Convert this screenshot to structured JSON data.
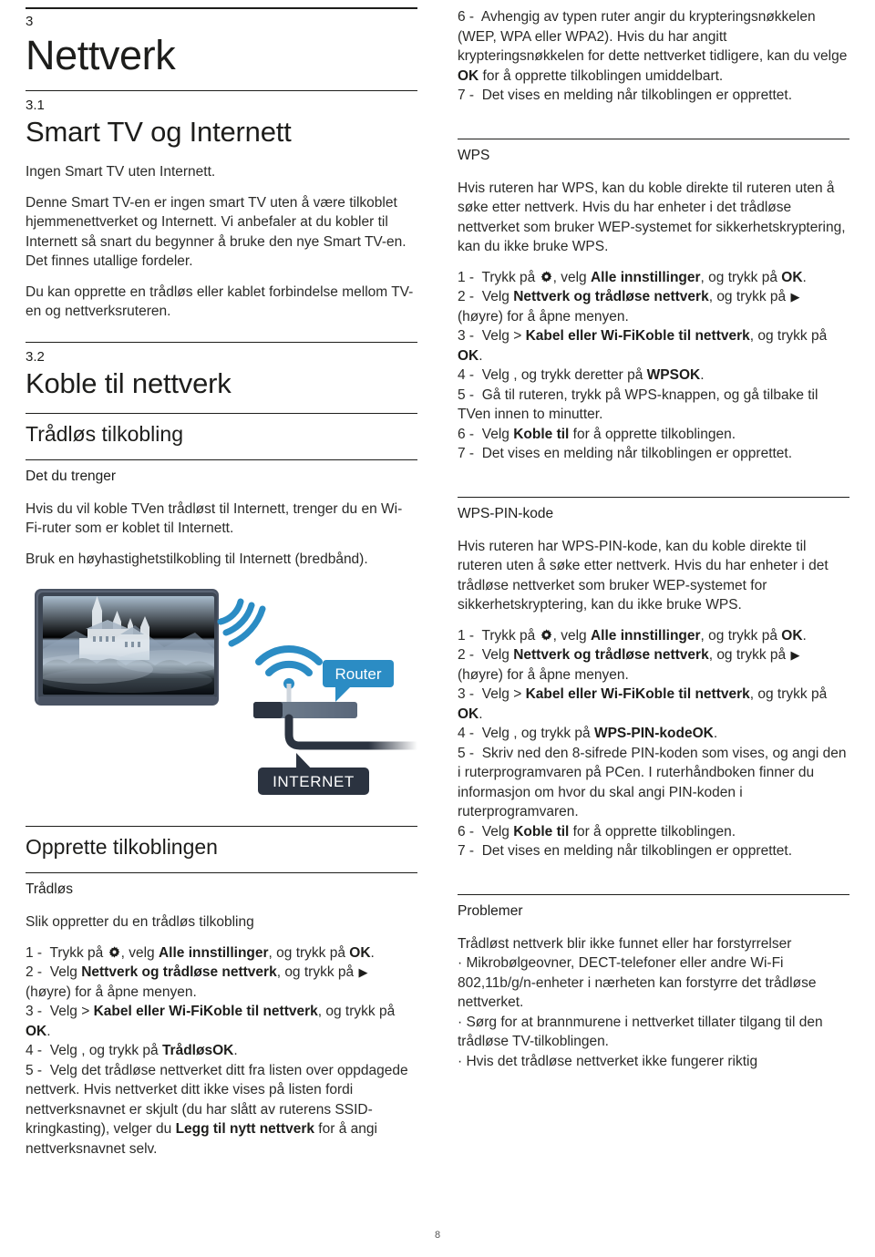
{
  "page": {
    "number": "8",
    "chapter_number": "3",
    "chapter_title": "Nettverk"
  },
  "left_column": {
    "section_3_1": {
      "number": "3.1",
      "title": "Smart TV og Internett",
      "lead": "Ingen Smart TV uten Internett.",
      "paragraph_1": "Denne Smart TV-en er ingen smart TV uten å være tilkoblet hjemmenettverket og Internett. Vi anbefaler at du kobler til Internett så snart du begynner å bruke den nye Smart TV-en. Det finnes utallige fordeler.",
      "paragraph_2": "Du kan opprette en trådløs eller kablet forbindelse mellom TV-en og nettverksruteren."
    },
    "section_3_2": {
      "number": "3.2",
      "title": "Koble til nettverk",
      "subhead_wireless": "Trådløs tilkobling",
      "minihead_needs": "Det du trenger",
      "needs_paragraph_1": "Hvis du vil koble TVen trådløst til Internett, trenger du en Wi-Fi-ruter som er koblet til Internett.",
      "needs_paragraph_2": "Bruk en høyhastighetstilkobling til Internett (bredbånd).",
      "illustration": {
        "router_label": "Router",
        "internet_label": "INTERNET",
        "tv_name": "tv-with-castle-image",
        "wifi_name": "wifi-signal-icon"
      },
      "subhead_connect": "Opprette tilkoblingen",
      "minihead_wireless": "Trådløs",
      "intro_wireless": "Slik oppretter du en trådløs tilkobling",
      "steps": [
        {
          "num": "1 -",
          "pre": "Trykk på ",
          "icon": "gear-icon",
          "mid": ", velg ",
          "bold1": "Alle innstillinger",
          "post": ", og trykk på ",
          "bold2": "OK",
          "tail": "."
        },
        {
          "num": "2 -",
          "pre": "Velg ",
          "bold1": "Nettverk og trådløse nettverk",
          "mid": ", og trykk på ",
          "icon": "arrow-right-icon",
          "post": " (høyre) for å åpne menyen."
        },
        {
          "num": "3 -",
          "pre": "Velg ",
          "bold1": "Kabel eller Wi-Fi",
          "mid": " > ",
          "bold2": "Koble til nettverk",
          "post": ", og trykk på ",
          "bold3": "OK",
          "tail": "."
        },
        {
          "num": "4 -",
          "pre": "Velg ",
          "bold1": "Trådløs",
          "mid": ", og trykk på ",
          "bold2": "OK",
          "tail": "."
        },
        {
          "num": "5 -",
          "pre": "Velg det trådløse nettverket ditt fra listen over oppdagede nettverk. Hvis nettverket ditt ikke vises på listen fordi nettverksnavnet er skjult (du har slått av ruterens SSID-kringkasting), velger du ",
          "bold1": "Legg til nytt nettverk",
          "post": " for å angi nettverksnavnet selv."
        }
      ]
    }
  },
  "right_column": {
    "continued_steps": [
      {
        "num": "6 -",
        "pre": "Avhengig av typen ruter angir du krypteringsnøkkelen (WEP, WPA eller WPA2). Hvis du har angitt krypteringsnøkkelen for dette nettverket tidligere, kan du velge ",
        "bold1": "OK",
        "post": " for å opprette tilkoblingen umiddelbart."
      },
      {
        "num": "7 -",
        "pre": "Det vises en melding når tilkoblingen er opprettet."
      }
    ],
    "wps": {
      "minihead": "WPS",
      "paragraph": "Hvis ruteren har WPS, kan du koble direkte til ruteren uten å søke etter nettverk. Hvis du har enheter i det trådløse nettverket som bruker WEP-systemet for sikkerhetskryptering, kan du ikke bruke WPS.",
      "steps": [
        {
          "num": "1 -",
          "pre": "Trykk på ",
          "icon": "gear-icon",
          "mid": ", velg ",
          "bold1": "Alle innstillinger",
          "post": ", og trykk på ",
          "bold2": "OK",
          "tail": "."
        },
        {
          "num": "2 -",
          "pre": "Velg ",
          "bold1": "Nettverk og trådløse nettverk",
          "mid": ", og trykk på ",
          "icon": "arrow-right-icon",
          "post": " (høyre) for å åpne menyen."
        },
        {
          "num": "3 -",
          "pre": "Velg ",
          "bold1": "Kabel eller Wi-Fi",
          "mid": " > ",
          "bold2": "Koble til nettverk",
          "post": ", og trykk på ",
          "bold3": "OK",
          "tail": "."
        },
        {
          "num": "4 -",
          "pre": "Velg ",
          "bold1": "WPS",
          "mid": ", og trykk deretter på ",
          "bold2": "OK",
          "tail": "."
        },
        {
          "num": "5 -",
          "pre": "Gå til ruteren, trykk på WPS-knappen, og gå tilbake til TVen innen to minutter."
        },
        {
          "num": "6 -",
          "pre": "Velg ",
          "bold1": "Koble til",
          "post": " for å opprette tilkoblingen."
        },
        {
          "num": "7 -",
          "pre": "Det vises en melding når tilkoblingen er opprettet."
        }
      ]
    },
    "wps_pin": {
      "minihead": "WPS-PIN-kode",
      "paragraph": "Hvis ruteren har WPS-PIN-kode, kan du koble direkte til ruteren uten å søke etter nettverk. Hvis du har enheter i det trådløse nettverket som bruker WEP-systemet for sikkerhetskryptering, kan du ikke bruke WPS.",
      "steps": [
        {
          "num": "1 -",
          "pre": "Trykk på ",
          "icon": "gear-icon",
          "mid": ", velg ",
          "bold1": "Alle innstillinger",
          "post": ", og trykk på ",
          "bold2": "OK",
          "tail": "."
        },
        {
          "num": "2 -",
          "pre": "Velg ",
          "bold1": "Nettverk og trådløse nettverk",
          "mid": ", og trykk på ",
          "icon": "arrow-right-icon",
          "post": " (høyre) for å åpne menyen."
        },
        {
          "num": "3 -",
          "pre": "Velg ",
          "bold1": "Kabel eller Wi-Fi",
          "mid": " > ",
          "bold2": "Koble til nettverk",
          "post": ", og trykk på ",
          "bold3": "OK",
          "tail": "."
        },
        {
          "num": "4 -",
          "pre": "Velg ",
          "bold1": "WPS-PIN-kode",
          "mid": ", og trykk på ",
          "bold2": "OK",
          "tail": "."
        },
        {
          "num": "5 -",
          "pre": "Skriv ned den 8-sifrede PIN-koden som vises, og angi den i ruterprogramvaren på PCen. I ruterhåndboken finner du informasjon om hvor du skal angi PIN-koden i ruterprogramvaren."
        },
        {
          "num": "6 -",
          "pre": "Velg ",
          "bold1": "Koble til",
          "post": " for å opprette tilkoblingen."
        },
        {
          "num": "7 -",
          "pre": "Det vises en melding når tilkoblingen er opprettet."
        }
      ]
    },
    "problems": {
      "minihead": "Problemer",
      "subtitle": "Trådløst nettverk blir ikke funnet eller har forstyrrelser",
      "bullets": [
        "Mikrobølgeovner, DECT-telefoner eller andre Wi-Fi 802,11b/g/n-enheter i nærheten kan forstyrre det trådløse nettverket.",
        "Sørg for at brannmurene i nettverket tillater tilgang til den trådløse TV-tilkoblingen.",
        "Hvis det trådløse nettverket ikke fungerer riktig"
      ]
    }
  },
  "colors": {
    "text": "#1d1d1b",
    "rule": "#1d1d1b",
    "accent_blue": "#2b8cc4",
    "router_label_bg": "#2b8cc4",
    "internet_label_bg": "#2b3340",
    "tv_bezel": "#4a5363"
  }
}
